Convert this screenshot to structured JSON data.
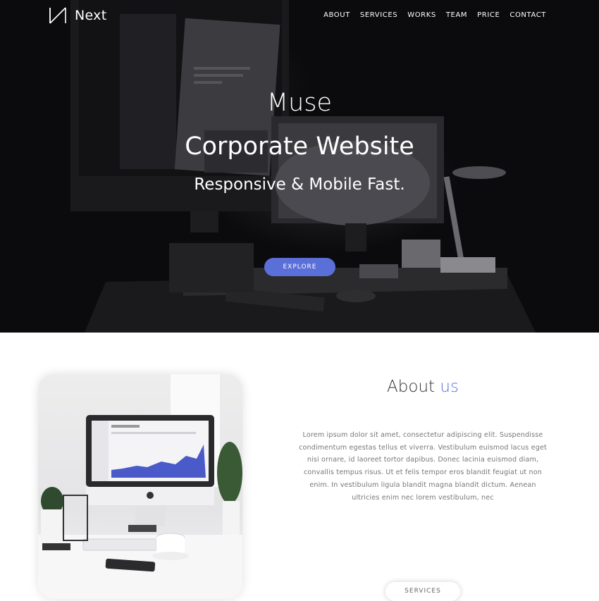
{
  "header": {
    "brand_name": "Next",
    "nav": [
      "ABOUT",
      "SERVICES",
      "WORKS",
      "TEAM",
      "PRICE",
      "CONTACT"
    ]
  },
  "hero": {
    "line1": "Muse",
    "line2": "Corporate Website",
    "line3": "Responsive & Mobile Fast.",
    "button_label": "EXPLORE"
  },
  "about": {
    "title_main": "About",
    "title_accent": "us",
    "body": "Lorem ipsum dolor sit amet, consectetur adipiscing elit. Suspendisse condimentum egestas tellus et viverra. Vestibulum euismod lacus eget nisi ornare, id laoreet tortor dapibus. Donec lacinia euismod diam, convallis tempus risus. Ut et felis tempor eros blandit feugiat ut non enim. In vestibulum ligula blandit magna blandit dictum. Aenean ultricies enim nec lorem vestibulum, nec",
    "button_label": "SERVICES"
  },
  "colors": {
    "accent": "#5b6fd8",
    "hero_bg": "#0b0b0d",
    "text_dark": "#333333",
    "text_muted": "#777777"
  },
  "icons": {
    "brand_logo": "n-logo-mark"
  }
}
